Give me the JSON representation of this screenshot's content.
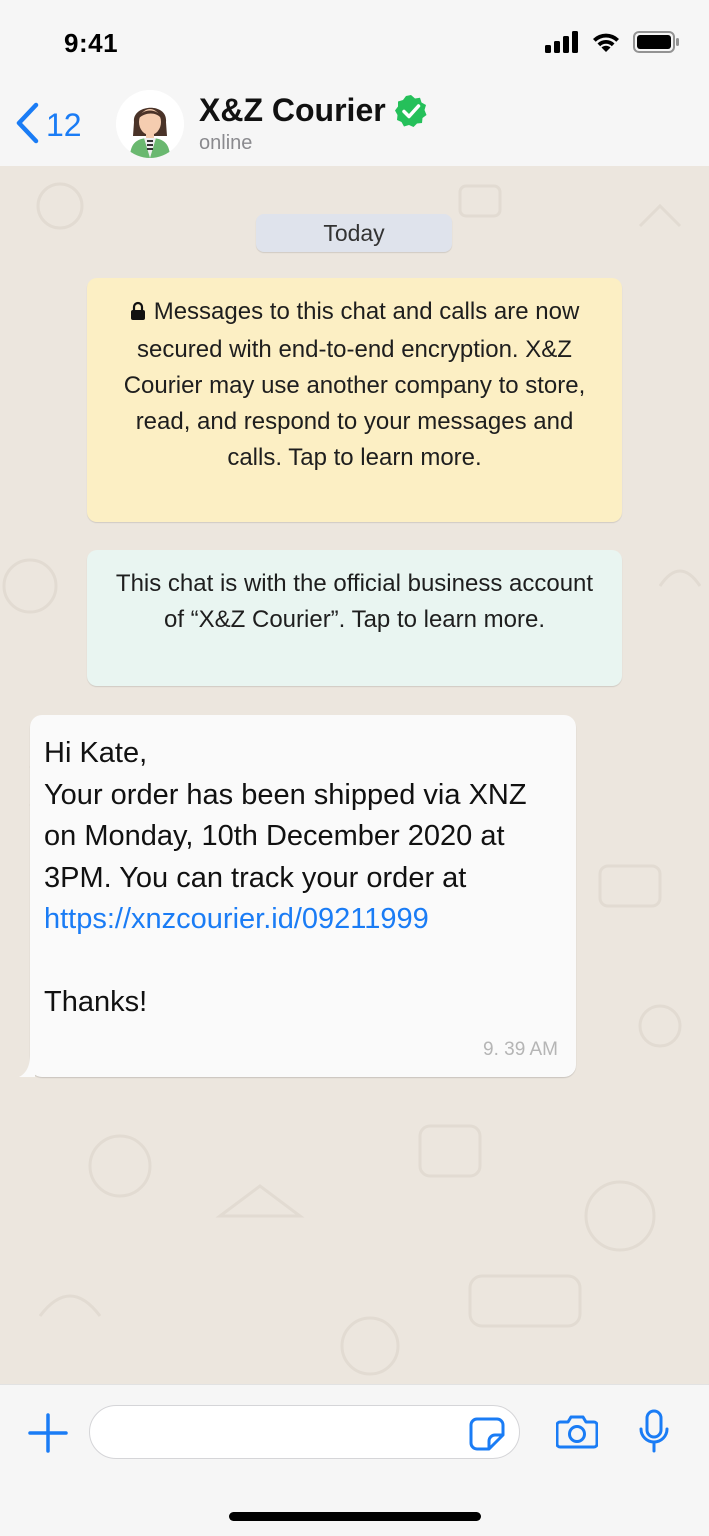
{
  "status_bar": {
    "time": "9:41"
  },
  "header": {
    "back_count": "12",
    "contact_name": "X&Z Courier",
    "contact_status": "online"
  },
  "chat": {
    "date_label": "Today",
    "encryption_notice": "Messages to this chat and calls are now secured with end-to-end encryption. X&Z Courier may use another company to store, read, and respond to your messages and calls. Tap to learn more.",
    "business_notice": "This chat is with the official business account of “X&Z Courier”. Tap to learn more.",
    "message": {
      "text": "Hi Kate,\nYour order has been shipped via XNZ on Monday, 10th December 2020 at 3PM. You can track your order at",
      "link": "https://xnzcourier.id/09211999",
      "closing": "Thanks!",
      "time": "9. 39 AM"
    }
  },
  "composer": {
    "input_value": ""
  },
  "colors": {
    "accent": "#1a7cf5",
    "verified": "#25c05a",
    "encryption_bg": "#fcefc4",
    "business_bg": "#e9f5f1",
    "chat_bg": "#ece6de"
  },
  "icons": [
    "chevron-left-icon",
    "verified-badge-icon",
    "lock-icon",
    "plus-icon",
    "sticker-icon",
    "camera-icon",
    "microphone-icon",
    "signal-icon",
    "wifi-icon",
    "battery-icon"
  ]
}
